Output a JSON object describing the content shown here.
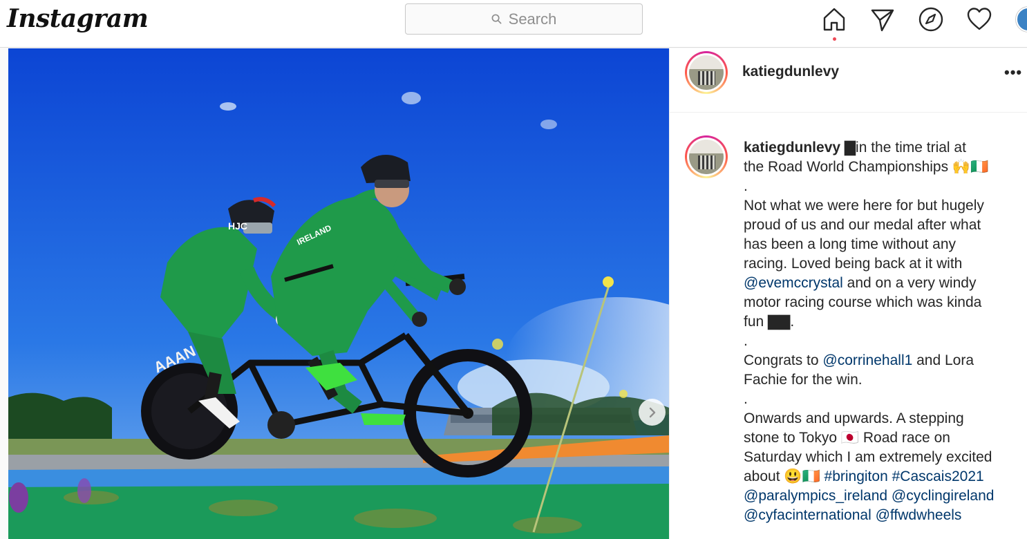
{
  "nav": {
    "logo": "Instagram",
    "search_placeholder": "Search",
    "icons": [
      "home-icon",
      "direct-icon",
      "explore-icon",
      "activity-heart-icon",
      "profile-avatar"
    ]
  },
  "post": {
    "username": "katiegdunlevy",
    "more_label": "•••",
    "caption": {
      "username": "katiegdunlevy",
      "lines": [
        {
          "parts": [
            {
              "t": "▇in the time trial at"
            }
          ]
        },
        {
          "parts": [
            {
              "t": "the Road World Championships 🙌🇮🇪"
            }
          ]
        },
        {
          "parts": [
            {
              "t": "."
            }
          ]
        },
        {
          "parts": [
            {
              "t": "Not what we were here for but hugely"
            }
          ]
        },
        {
          "parts": [
            {
              "t": "proud of us and our medal after what"
            }
          ]
        },
        {
          "parts": [
            {
              "t": "has been a long time without any"
            }
          ]
        },
        {
          "parts": [
            {
              "t": "racing. Loved being back at it with"
            }
          ]
        },
        {
          "parts": [
            {
              "t": "@evemccrystal",
              "link": true
            },
            {
              "t": " and on a very windy"
            }
          ]
        },
        {
          "parts": [
            {
              "t": "motor racing course which was kinda"
            }
          ]
        },
        {
          "parts": [
            {
              "t": "fun ▇▇."
            }
          ]
        },
        {
          "parts": [
            {
              "t": "."
            }
          ]
        },
        {
          "parts": [
            {
              "t": "Congrats to "
            },
            {
              "t": "@corrinehall1",
              "link": true
            },
            {
              "t": " and Lora"
            }
          ]
        },
        {
          "parts": [
            {
              "t": "Fachie for the win."
            }
          ]
        },
        {
          "parts": [
            {
              "t": "."
            }
          ]
        },
        {
          "parts": [
            {
              "t": "Onwards and upwards. A stepping"
            }
          ]
        },
        {
          "parts": [
            {
              "t": "stone to Tokyo 🇯🇵 Road race on"
            }
          ]
        },
        {
          "parts": [
            {
              "t": "Saturday which I am extremely excited"
            }
          ]
        },
        {
          "parts": [
            {
              "t": "about 😃🇮🇪 "
            },
            {
              "t": "#bringiton",
              "link": true
            },
            {
              "t": " "
            },
            {
              "t": "#Cascais2021",
              "link": true
            }
          ]
        },
        {
          "parts": [
            {
              "t": "@paralympics_ireland",
              "link": true
            },
            {
              "t": " "
            },
            {
              "t": "@cyclingireland",
              "link": true
            }
          ]
        },
        {
          "parts": [
            {
              "t": "@cyfacinternational",
              "link": true
            },
            {
              "t": " "
            },
            {
              "t": "@ffwdwheels",
              "link": true
            }
          ]
        }
      ]
    },
    "image": {
      "jersey_text": "IRELAND",
      "helmet_text": "HJC",
      "wheel_text": "AAAN"
    }
  },
  "colors": {
    "link": "#00376b",
    "jersey": "#1f9a4a",
    "sky": "#1657d6",
    "shoe": "#3fe03f"
  }
}
